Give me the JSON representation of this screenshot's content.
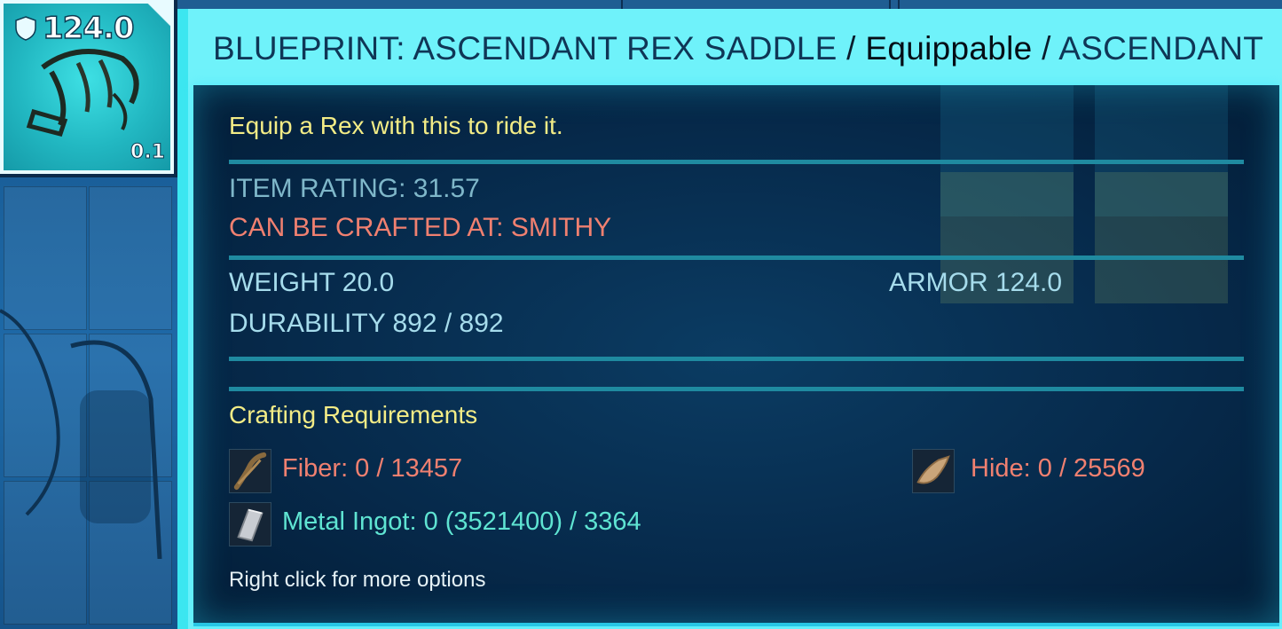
{
  "item_slot": {
    "armor_value": "124.0",
    "weight_value": "0.1",
    "icon": "rex-saddle-icon"
  },
  "tooltip": {
    "title_prefix": "BLUEPRINT: ASCENDANT REX SADDLE",
    "separator": " / ",
    "title_type": "Equippable",
    "title_quality": "ASCENDANT",
    "description": "Equip a Rex with this to ride it.",
    "item_rating": "ITEM RATING: 31.57",
    "crafted_at": "CAN BE CRAFTED AT: SMITHY",
    "weight": "WEIGHT 20.0",
    "armor": "ARMOR 124.0",
    "durability": "DURABILITY 892 / 892",
    "crafting_header": "Crafting Requirements",
    "resources": [
      {
        "label": "Fiber: 0 / 13457",
        "icon": "fiber-icon",
        "status": "missing"
      },
      {
        "label": "Hide: 0 / 25569",
        "icon": "hide-icon",
        "status": "missing"
      },
      {
        "label": "Metal Ingot: 0 (3521400) / 3364",
        "icon": "metal-ingot-icon",
        "status": "available"
      }
    ],
    "hint": "Right click for more options"
  },
  "colors": {
    "tooltip_frame": "#3ce6f0",
    "title_text": "#0f3656",
    "description": "#f3ec86",
    "missing_requirement": "#f08070",
    "available_requirement": "#5fe4d2",
    "stat_text": "#a6dcec"
  }
}
